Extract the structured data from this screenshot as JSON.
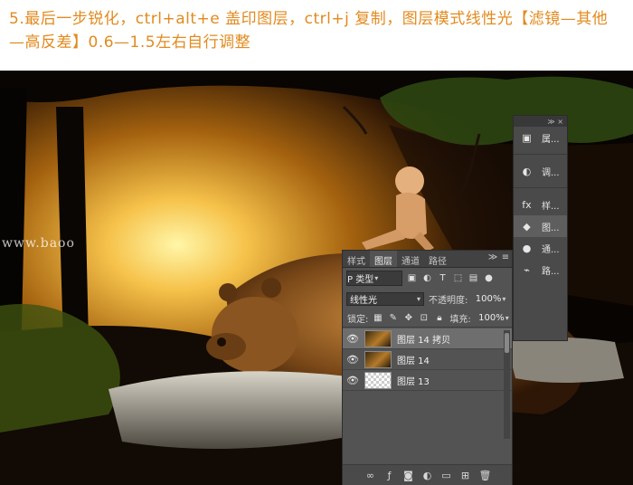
{
  "caption": {
    "text": "5.最后一步锐化，ctrl+alt+e 盖印图层，ctrl+j 复制，图层模式线性光【滤镜—其他—高反差】0.6—1.5左右自行调整"
  },
  "watermark": {
    "text": "www.baoo"
  },
  "layers_panel": {
    "tabs": [
      "样式",
      "图层",
      "通道",
      "路径"
    ],
    "active_tab": "图层",
    "tab_menu": "≫",
    "filter": {
      "label": "P 类型",
      "caret": "▾"
    },
    "filter_icons": [
      "image-filter-icon",
      "adjustment-filter-icon",
      "type-filter-icon",
      "shape-filter-icon",
      "smart-object-filter-icon"
    ],
    "blend_mode": {
      "value": "线性光",
      "caret": "▾"
    },
    "opacity": {
      "label": "不透明度:",
      "value": "100%"
    },
    "lock": {
      "label": "锁定:"
    },
    "fill": {
      "label": "填充:",
      "value": "100%"
    },
    "layers": [
      {
        "name": "图层 14 拷贝",
        "thumb": "photo",
        "selected": true
      },
      {
        "name": "图层 14",
        "thumb": "photo",
        "selected": false
      },
      {
        "name": "图层 13",
        "thumb": "checker",
        "selected": false
      }
    ],
    "footer_icons": [
      "link-icon",
      "fx-icon",
      "mask-icon",
      "adjustment-icon",
      "folder-icon",
      "new-layer-icon",
      "trash-icon"
    ]
  },
  "dock": {
    "top_controls": "≫  ×",
    "items": [
      {
        "icon": "properties-icon",
        "label": "属..."
      },
      {
        "icon": "adjustments-icon",
        "label": "调..."
      },
      {
        "icon": "styles-icon",
        "label": "样..."
      },
      {
        "icon": "layers-icon",
        "label": "图...",
        "selected": true
      },
      {
        "icon": "channels-icon",
        "label": "通..."
      },
      {
        "icon": "paths-icon",
        "label": "路..."
      }
    ]
  }
}
